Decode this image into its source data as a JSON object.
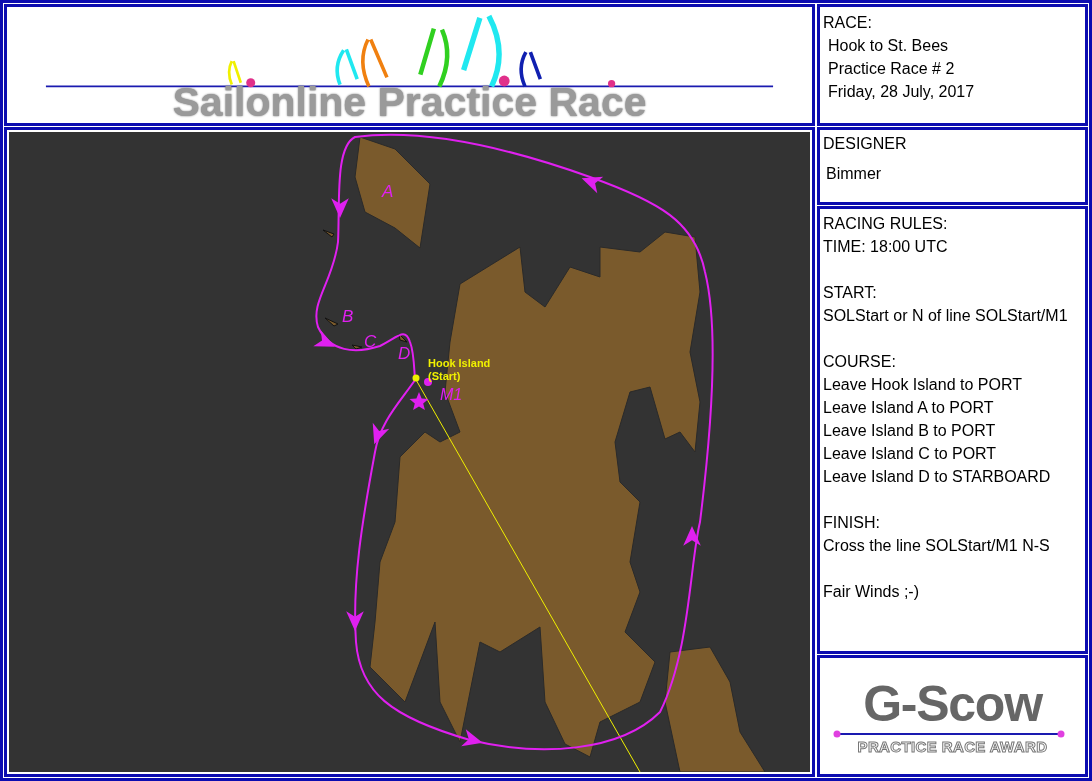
{
  "header": {
    "title": "Sailonline Practice Race"
  },
  "map": {
    "island_labels": [
      "A",
      "B",
      "C",
      "D"
    ],
    "start_label": [
      "Hook Island",
      "(Start)"
    ],
    "mark_label": "M1"
  },
  "race": {
    "heading": "RACE:",
    "lines": [
      "Hook to St. Bees",
      "Practice Race # 2",
      "Friday, 28 July, 2017"
    ]
  },
  "designer": {
    "heading": "DESIGNER",
    "name": "Bimmer"
  },
  "rules": {
    "heading": "RACING RULES:",
    "blocks": [
      {
        "lines": [
          "TIME: 18:00 UTC"
        ]
      },
      {
        "lines": [
          "START:",
          "SOLStart or N of line SOLStart/M1"
        ]
      },
      {
        "lines": [
          "COURSE:",
          "Leave Hook Island to PORT",
          "Leave Island A to PORT",
          "Leave Island B to PORT",
          "Leave Island C to PORT",
          "Leave Island D to STARBOARD"
        ]
      },
      {
        "lines": [
          "FINISH:",
          "Cross the line SOLStart/M1 N-S"
        ]
      },
      {
        "lines": [
          "Fair Winds ;-)"
        ]
      }
    ]
  },
  "award": {
    "title": "G-Scow",
    "subtitle": "PRACTICE RACE AWARD"
  }
}
